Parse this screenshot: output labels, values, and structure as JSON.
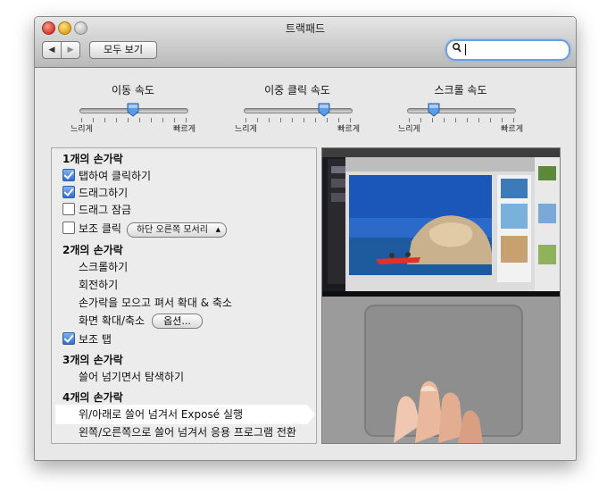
{
  "window": {
    "title": "트랙패드"
  },
  "toolbar": {
    "back_label": "◀",
    "forward_label": "▶",
    "show_all_label": "모두 보기",
    "search_value": ""
  },
  "sliders": [
    {
      "label": "이동 속도",
      "min_label": "느리게",
      "max_label": "빠르게",
      "value": 0.5
    },
    {
      "label": "이중 클릭 속도",
      "min_label": "느리게",
      "max_label": "빠르게",
      "value": 0.75
    },
    {
      "label": "스크롤 속도",
      "min_label": "느리게",
      "max_label": "빠르게",
      "value": 0.25
    }
  ],
  "one_finger": {
    "num": "1",
    "heading": "개의 손가락",
    "tap_to_click": {
      "label": "탭하여 클릭하기",
      "checked": true
    },
    "dragging": {
      "label": "드래그하기",
      "checked": true
    },
    "drag_lock": {
      "label": "드래그 잠금",
      "checked": false
    },
    "secondary_click": {
      "label": "보조 클릭",
      "checked": false,
      "popup_value": "하단 오른쪽 모서리"
    }
  },
  "two_fingers": {
    "num": "2",
    "heading": "개의 손가락",
    "scroll": "스크롤하기",
    "rotate": "회전하기",
    "pinch": "손가락을 모으고 펴서 확대 & 축소",
    "screen_zoom": "화면 확대/축소",
    "options_button": "옵션...",
    "secondary_tap": {
      "label": "보조 탭",
      "checked": true
    }
  },
  "three_fingers": {
    "num": "3",
    "heading": "개의 손가락",
    "swipe": "쓸어 넘기면서 탐색하기"
  },
  "four_fingers": {
    "num": "4",
    "heading": "개의 손가락",
    "expose": "위/아래로 쓸어 넘겨서 Exposé 실행",
    "app_switch": "왼쪽/오른쪽으로 쓸어 넘겨서 응용 프로그램 전환"
  }
}
